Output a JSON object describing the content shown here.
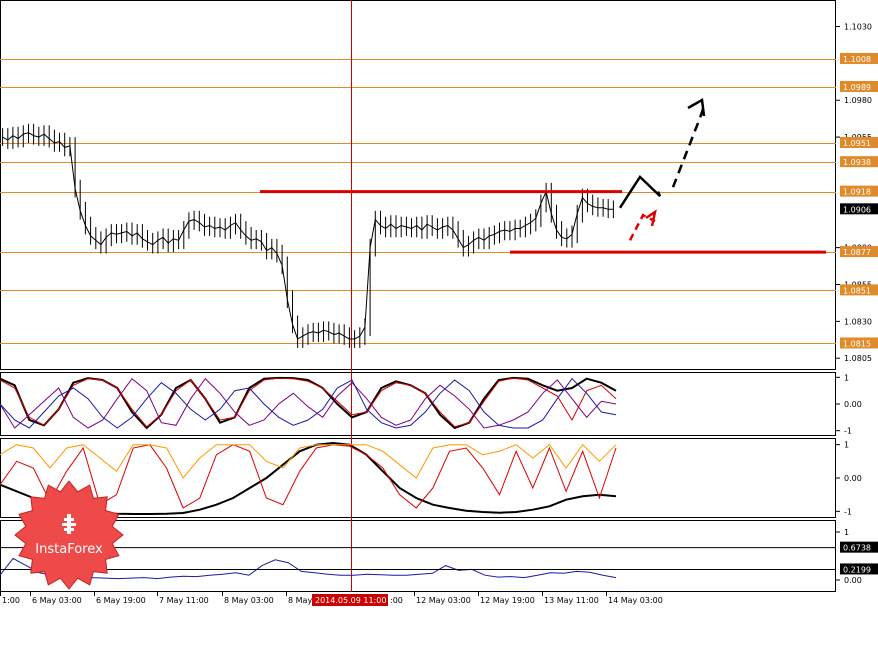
{
  "chart_data": [
    {
      "type": "line",
      "panel": "main",
      "ylim": [
        1.0797,
        1.1048
      ],
      "right_axis_ticks": [
        "1.1030",
        "1.0980",
        "1.0955",
        "1.0880",
        "1.0855",
        "1.0830",
        "1.0805"
      ],
      "price_level_labels": [
        "1.1008",
        "1.0989",
        "1.0951",
        "1.0938",
        "1.0918",
        "1.0877",
        "1.0851",
        "1.0815"
      ],
      "current_price_label": "1.0906",
      "current_price": 1.0906,
      "resistance_level": 1.0918,
      "support_level": 1.0877,
      "x_tick_labels": [
        "1:00",
        "6 May 03:00",
        "6 May 19:00",
        "7 May 11:00",
        "8 May 03:00",
        "8 May",
        "2014.05.09 11:00",
        "12 May 03:00",
        "12 May 19:00",
        "13 May 11:00",
        "14 May 03:00"
      ],
      "x_tick_suffix_after_badge": ":00",
      "highlighted_time": "2014.05.09 11:00",
      "series": [
        {
          "values": [
            1.0955,
            1.0953,
            1.0956,
            1.0954,
            1.0957,
            1.0958,
            1.0956,
            1.0955,
            1.0957,
            1.0954,
            1.0951,
            1.0952,
            1.0948,
            1.0949,
            1.092,
            1.0905,
            1.0895,
            1.0888,
            1.0885,
            1.0882,
            1.0887,
            1.089,
            1.0889,
            1.089,
            1.0891,
            1.0888,
            1.089,
            1.0886,
            1.0884,
            1.0882,
            1.0885,
            1.0887,
            1.0883,
            1.0886,
            1.0885,
            1.0892,
            1.0898,
            1.0899,
            1.0897,
            1.0894,
            1.0895,
            1.0893,
            1.0894,
            1.0892,
            1.0895,
            1.0897,
            1.0892,
            1.0888,
            1.0885,
            1.0886,
            1.0884,
            1.0878,
            1.088,
            1.0876,
            1.0868,
            1.0845,
            1.0828,
            1.0818,
            1.082,
            1.0822,
            1.0823,
            1.0822,
            1.0824,
            1.0823,
            1.0821,
            1.0822,
            1.082,
            1.0818,
            1.0818,
            1.082,
            1.0826,
            1.088,
            1.0899,
            1.0895,
            1.0893,
            1.0896,
            1.0893,
            1.0895,
            1.0894,
            1.0893,
            1.0895,
            1.0892,
            1.0896,
            1.0894,
            1.0892,
            1.0894,
            1.0895,
            1.0892,
            1.0886,
            1.088,
            1.0882,
            1.0885,
            1.0887,
            1.0885,
            1.0888,
            1.0889,
            1.0891,
            1.0892,
            1.0891,
            1.0893,
            1.0893,
            1.0895,
            1.0897,
            1.09,
            1.091,
            1.0918,
            1.0903,
            1.0892,
            1.0887,
            1.0886,
            1.0889,
            1.0903,
            1.0914,
            1.091,
            1.0908,
            1.0907,
            1.0907,
            1.0906,
            1.0906
          ]
        }
      ],
      "forecast_path": [
        [
          1.0907,
          1.0928,
          1.0915,
          1.0918
        ],
        [
          1.0921,
          1.0968,
          1.0978
        ]
      ],
      "alt_path": [
        [
          1.0885,
          1.0902,
          1.0898
        ]
      ]
    },
    {
      "type": "line",
      "panel": "oscillator-1",
      "ylim": [
        -1.2,
        1.2
      ],
      "right_axis_ticks": [
        "1",
        "0.00",
        "-1"
      ],
      "series": [
        {
          "color": "#000000",
          "values": [
            0.95,
            0.7,
            -0.6,
            -0.8,
            -0.2,
            0.8,
            0.97,
            0.9,
            0.6,
            -0.3,
            -0.9,
            -0.4,
            0.6,
            0.9,
            0.2,
            -0.7,
            -0.5,
            0.6,
            0.95,
            0.98,
            0.97,
            0.9,
            0.6,
            0.0,
            -0.5,
            -0.3,
            0.6,
            0.85,
            0.7,
            0.4,
            -0.4,
            -0.9,
            -0.7,
            0.2,
            0.9,
            0.98,
            0.95,
            0.7,
            0.5,
            0.6,
            0.95,
            0.8,
            0.5
          ]
        },
        {
          "color": "#dd0000",
          "values": [
            0.9,
            0.6,
            -0.5,
            -0.8,
            -0.2,
            0.7,
            0.95,
            0.9,
            0.6,
            -0.2,
            -0.85,
            -0.4,
            0.5,
            0.9,
            0.2,
            -0.6,
            -0.5,
            0.5,
            0.9,
            0.97,
            0.95,
            0.85,
            0.6,
            0.1,
            -0.4,
            -0.3,
            0.5,
            0.8,
            0.7,
            0.4,
            -0.3,
            -0.85,
            -0.7,
            0.1,
            0.85,
            0.97,
            0.9,
            0.6,
            0.3,
            -0.6,
            0.5,
            0.7,
            0.2
          ]
        },
        {
          "color": "#800080",
          "values": [
            0.0,
            -0.9,
            -0.4,
            0.1,
            0.6,
            -0.5,
            -0.9,
            -0.6,
            0.2,
            0.95,
            0.5,
            -0.7,
            -0.8,
            0.2,
            0.95,
            0.4,
            -0.3,
            -0.8,
            -0.6,
            0.0,
            0.4,
            -0.1,
            -0.5,
            0.3,
            0.8,
            0.2,
            -0.5,
            -0.8,
            -0.6,
            0.2,
            0.7,
            0.3,
            -0.2,
            -0.9,
            -0.8,
            -0.6,
            -0.3,
            0.4,
            0.9,
            0.2,
            -0.5,
            0.1,
            0.0
          ]
        },
        {
          "color": "#1a1aaa",
          "values": [
            0.0,
            -0.6,
            -0.9,
            -0.3,
            0.3,
            0.6,
            0.2,
            -0.5,
            -0.9,
            -0.5,
            0.2,
            0.8,
            0.4,
            -0.2,
            -0.6,
            -0.2,
            0.5,
            0.6,
            0.0,
            -0.5,
            -0.8,
            -0.6,
            -0.2,
            0.6,
            0.9,
            -0.2,
            -0.7,
            -0.9,
            -0.8,
            -0.3,
            0.4,
            0.9,
            0.5,
            -0.3,
            -0.8,
            -0.9,
            -0.9,
            -0.6,
            0.2,
            0.95,
            0.4,
            -0.3,
            -0.4
          ]
        }
      ]
    },
    {
      "type": "line",
      "panel": "oscillator-2",
      "ylim": [
        -1.2,
        1.2
      ],
      "right_axis_ticks": [
        "1",
        "0.00",
        "-1"
      ],
      "series": [
        {
          "color": "#000000",
          "values": [
            -0.2,
            -0.4,
            -0.6,
            -0.8,
            -0.95,
            -1.0,
            -1.05,
            -1.07,
            -1.08,
            -1.08,
            -1.07,
            -1.05,
            -0.95,
            -0.8,
            -0.6,
            -0.3,
            0.0,
            0.4,
            0.8,
            1.0,
            1.05,
            1.0,
            0.7,
            0.2,
            -0.3,
            -0.6,
            -0.8,
            -0.9,
            -0.98,
            -1.02,
            -1.04,
            -1.02,
            -0.95,
            -0.85,
            -0.65,
            -0.55,
            -0.5,
            -0.55
          ]
        },
        {
          "color": "#dd0000",
          "values": [
            -0.2,
            0.5,
            0.3,
            -0.7,
            0.2,
            0.9,
            -0.8,
            -0.5,
            0.9,
            1.0,
            0.3,
            -0.9,
            -0.6,
            0.7,
            1.0,
            0.8,
            -0.6,
            -0.8,
            0.2,
            0.9,
            1.0,
            0.95,
            0.7,
            0.3,
            -0.5,
            -0.9,
            -0.3,
            0.8,
            0.9,
            0.3,
            -0.5,
            0.8,
            -0.3,
            0.9,
            -0.4,
            0.8,
            -0.6,
            0.9
          ]
        },
        {
          "color": "#ff9900",
          "values": [
            0.7,
            1.0,
            0.9,
            0.3,
            0.9,
            1.0,
            0.6,
            0.2,
            1.0,
            1.0,
            0.9,
            0.0,
            0.6,
            1.0,
            1.0,
            1.0,
            0.5,
            0.3,
            0.9,
            1.0,
            1.0,
            1.0,
            1.0,
            0.8,
            0.4,
            0.0,
            0.9,
            1.0,
            1.0,
            0.7,
            0.8,
            1.0,
            0.6,
            1.0,
            0.3,
            1.0,
            0.5,
            1.0
          ]
        }
      ]
    },
    {
      "type": "line",
      "panel": "oscillator-3",
      "ylim": [
        -0.25,
        1.25
      ],
      "right_axis_ticks": [
        "1",
        "0.00"
      ],
      "level_labels": [
        "0.6738",
        "0.2199"
      ],
      "levels": [
        0.6738,
        0.2199
      ],
      "series": [
        {
          "color": "#1a1aaa",
          "values": [
            0.1,
            0.45,
            0.3,
            0.15,
            0.1,
            0.05,
            0.04,
            0.05,
            0.04,
            0.03,
            0.04,
            0.05,
            0.03,
            0.06,
            0.08,
            0.07,
            0.1,
            0.12,
            0.15,
            0.1,
            0.3,
            0.42,
            0.36,
            0.18,
            0.15,
            0.12,
            0.1,
            0.1,
            0.12,
            0.11,
            0.1,
            0.1,
            0.12,
            0.14,
            0.3,
            0.2,
            0.22,
            0.1,
            0.06,
            0.07,
            0.05,
            0.1,
            0.15,
            0.14,
            0.18,
            0.16,
            0.1,
            0.05
          ]
        }
      ]
    }
  ],
  "logo": {
    "text": "InstaForex"
  }
}
